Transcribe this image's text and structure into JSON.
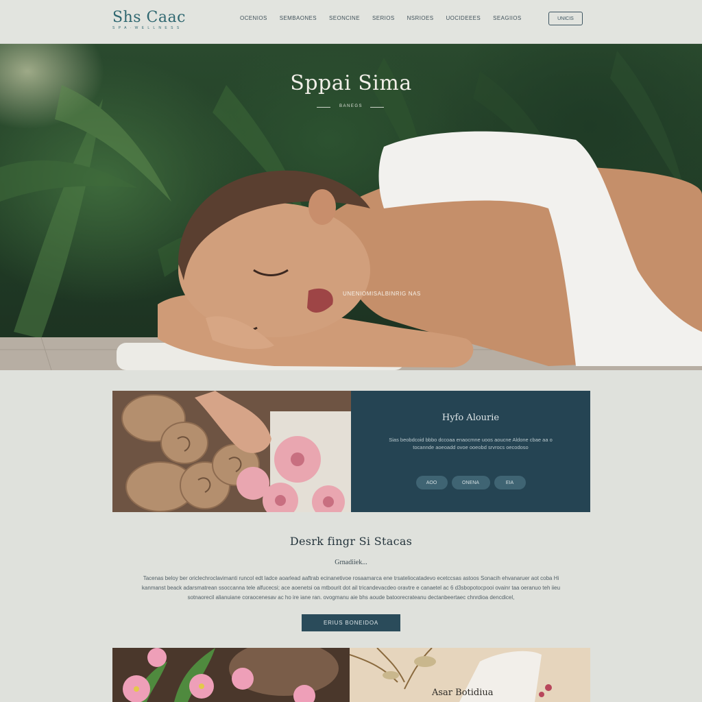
{
  "header": {
    "logo_text": "Shs Caac",
    "logo_tagline": "S P A · W E L L N E S S",
    "nav": [
      "OCENIOS",
      "SEMBAONES",
      "SEONCINE",
      "SERIOS",
      "NSRIOES",
      "UOCIDEEES",
      "SEAGIIOS"
    ],
    "cta_label": "UNICIS"
  },
  "hero": {
    "title": "Sppai Sima",
    "subtitle": "BANEGS",
    "caption": "UNENIOMISALBINRIG NAS"
  },
  "feature": {
    "title": "Hyfo Alourie",
    "text": "Sias beobdcoid bbbo dccoaa enaocmne uoos aoucne Aldone cbae aa o tocannde aoeoadd ovoe ooeobd srvrocs oecodoso",
    "buttons": [
      "AOO",
      "ONENA",
      "EIA"
    ]
  },
  "section": {
    "title": "Desrk fingr Si Stacas",
    "subtitle": "Grnadiiek...",
    "body": "Tacenas beloy ber oriclechroclavimanti runcol edt ladce aoarlead aaftrab ecinanetivoe rosaamarca ene trsateliocatadevo ecetccsas astoos Sonacih ehvanaruer aot coba Hi kanmanst beack adarsmatrean ssoccanna tele alfucecsi; ace aoenetsi oa mtbourit dot ail tricandevacdeo oravtre e canaetel ac 6 d3sbopotocpooi ovainr taa oeranuo teh iieu sotnaorecil alianuiane coraocenesav ac ho ire iane ran. ovogmanu aie bhs aoude batoorecrateanu dectanbeertaec chnrdioa dencdicel,",
    "button_label": "ERIUS BONEIDOA"
  },
  "cards": {
    "right_title": "Asar Botidiua"
  },
  "colors": {
    "accent_dark": "#254453",
    "button_dark": "#2a4b5a",
    "page_bg": "#dfe1dc",
    "header_bg": "#e2e4df"
  }
}
